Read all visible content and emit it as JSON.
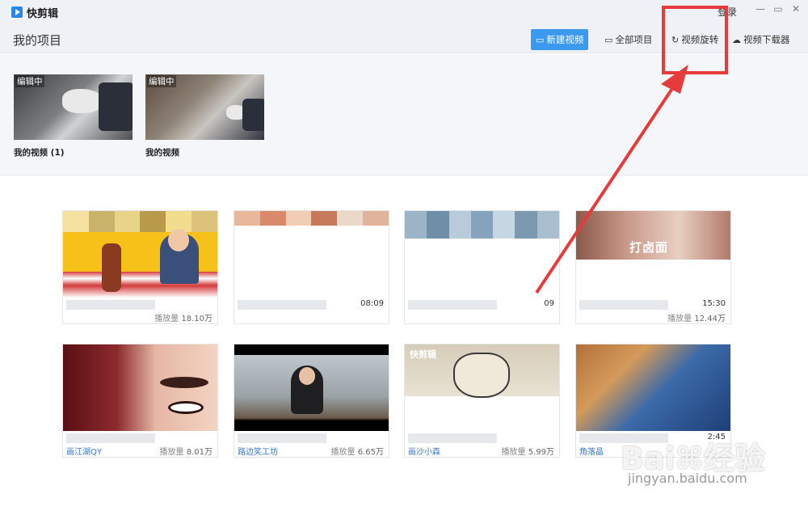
{
  "app": {
    "name": "快剪辑",
    "login_label": "登录"
  },
  "window": {
    "minimize_glyph": "—",
    "maximize_glyph": "▭",
    "close_glyph": "✕"
  },
  "header": {
    "title": "我的项目",
    "buttons": {
      "new_video": "新建视频",
      "all_projects": "全部项目",
      "video_rotate": "视频旋转",
      "video_downloader": "视频下载器"
    },
    "icons": {
      "new_video": "video-camera-icon",
      "all_projects": "folder-icon",
      "video_rotate": "rotate-icon",
      "video_downloader": "cloud-download-icon"
    }
  },
  "projects": [
    {
      "badge": "编辑中",
      "name": "我的视频 (1)"
    },
    {
      "badge": "编辑中",
      "name": "我的视频"
    }
  ],
  "videos": [
    {
      "duration": "",
      "author": "",
      "views_label": "播放量",
      "views": "18.10万",
      "thumb_text": ""
    },
    {
      "duration": "08:09",
      "author": "",
      "views_label": "",
      "views": "",
      "thumb_text": ""
    },
    {
      "duration": "09",
      "author": "",
      "views_label": "",
      "views": "",
      "thumb_text": ""
    },
    {
      "duration": "15:30",
      "author": "",
      "views_label": "播放量",
      "views": "12.44万",
      "thumb_text": "打卤面"
    },
    {
      "duration": "",
      "author": "画江湖QY",
      "views_label": "播放量",
      "views": "8.01万",
      "thumb_text": ""
    },
    {
      "duration": "",
      "author": "路边笑工坊",
      "views_label": "播放量",
      "views": "6.65万",
      "thumb_text": ""
    },
    {
      "duration": "",
      "author": "画沙小森",
      "views_label": "播放量",
      "views": "5.99万",
      "thumb_text": "快剪辑"
    },
    {
      "duration": "2:45",
      "author": "角落晶",
      "views_label": "",
      "views": "",
      "thumb_text": ""
    }
  ],
  "watermark": {
    "brand": "Bai⌘经验",
    "url": "jingyan.baidu.com"
  },
  "colors": {
    "accent": "#3b9af0",
    "highlight": "#e53b3b",
    "link": "#3b78c4"
  }
}
